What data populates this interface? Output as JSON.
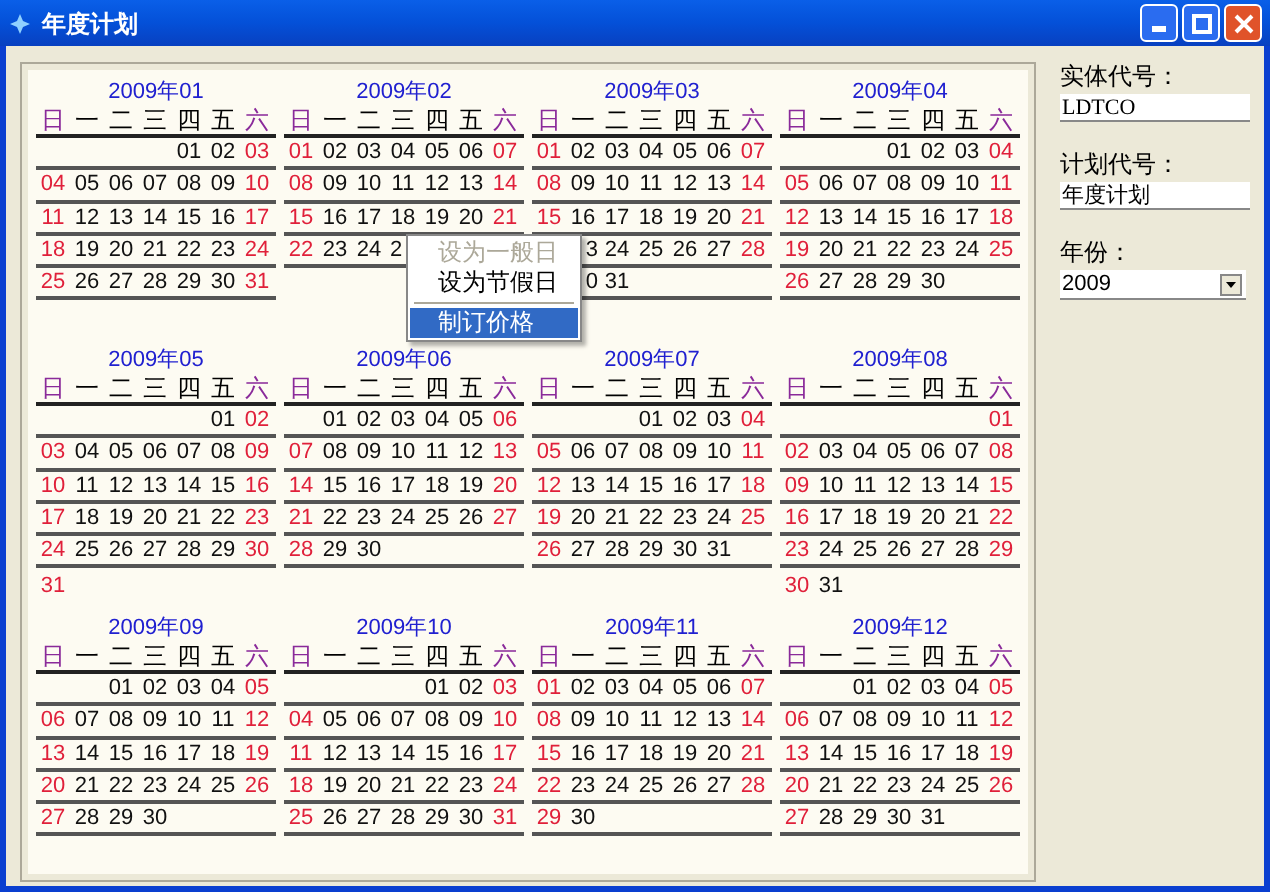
{
  "window": {
    "title": "年度计划"
  },
  "months": [
    {
      "title": "2009年01",
      "weekdays": [
        "日",
        "一",
        "二",
        "三",
        "四",
        "五",
        "六"
      ],
      "weeks": [
        [
          {
            "kind": "blank"
          },
          {
            "kind": "blank"
          },
          {
            "kind": "blank"
          },
          {
            "kind": "blank"
          },
          {
            "kind": "day",
            "text": "01"
          },
          {
            "kind": "day",
            "text": "02"
          },
          {
            "kind": "day",
            "text": "03"
          }
        ],
        [
          {
            "kind": "day",
            "text": "04"
          },
          {
            "kind": "day",
            "text": "05"
          },
          {
            "kind": "day",
            "text": "06"
          },
          {
            "kind": "day",
            "text": "07"
          },
          {
            "kind": "day",
            "text": "08"
          },
          {
            "kind": "day",
            "text": "09"
          },
          {
            "kind": "day",
            "text": "10"
          }
        ],
        [
          {
            "kind": "day",
            "text": "11"
          },
          {
            "kind": "day",
            "text": "12"
          },
          {
            "kind": "day",
            "text": "13"
          },
          {
            "kind": "day",
            "text": "14"
          },
          {
            "kind": "day",
            "text": "15"
          },
          {
            "kind": "day",
            "text": "16"
          },
          {
            "kind": "day",
            "text": "17"
          }
        ],
        [
          {
            "kind": "day",
            "text": "18"
          },
          {
            "kind": "day",
            "text": "19"
          },
          {
            "kind": "day",
            "text": "20"
          },
          {
            "kind": "day",
            "text": "21"
          },
          {
            "kind": "day",
            "text": "22"
          },
          {
            "kind": "day",
            "text": "23"
          },
          {
            "kind": "day",
            "text": "24"
          }
        ],
        [
          {
            "kind": "day",
            "text": "25"
          },
          {
            "kind": "day",
            "text": "26"
          },
          {
            "kind": "day",
            "text": "27"
          },
          {
            "kind": "day",
            "text": "28"
          },
          {
            "kind": "day",
            "text": "29"
          },
          {
            "kind": "day",
            "text": "30"
          },
          {
            "kind": "day",
            "text": "31"
          }
        ]
      ]
    },
    {
      "title": "2009年02",
      "weekdays": [
        "日",
        "一",
        "二",
        "三",
        "四",
        "五",
        "六"
      ],
      "weeks": [
        [
          {
            "kind": "day",
            "text": "01"
          },
          {
            "kind": "day",
            "text": "02"
          },
          {
            "kind": "day",
            "text": "03"
          },
          {
            "kind": "day",
            "text": "04"
          },
          {
            "kind": "day",
            "text": "05"
          },
          {
            "kind": "day",
            "text": "06"
          },
          {
            "kind": "day",
            "text": "07"
          }
        ],
        [
          {
            "kind": "day",
            "text": "08"
          },
          {
            "kind": "day",
            "text": "09"
          },
          {
            "kind": "day",
            "text": "10"
          },
          {
            "kind": "day",
            "text": "11"
          },
          {
            "kind": "day",
            "text": "12"
          },
          {
            "kind": "day",
            "text": "13"
          },
          {
            "kind": "day",
            "text": "14"
          }
        ],
        [
          {
            "kind": "day",
            "text": "15"
          },
          {
            "kind": "day",
            "text": "16"
          },
          {
            "kind": "day",
            "text": "17"
          },
          {
            "kind": "day",
            "text": "18"
          },
          {
            "kind": "day",
            "text": "19"
          },
          {
            "kind": "day",
            "text": "20"
          },
          {
            "kind": "day",
            "text": "21"
          }
        ],
        [
          {
            "kind": "day",
            "text": "22"
          },
          {
            "kind": "day",
            "text": "23"
          },
          {
            "kind": "day",
            "text": "24"
          },
          {
            "kind": "cut_start",
            "text": "2"
          }
        ]
      ]
    },
    {
      "title": "2009年03",
      "weekdays": [
        "日",
        "一",
        "二",
        "三",
        "四",
        "五",
        "六"
      ],
      "weeks": [
        [
          {
            "kind": "day",
            "text": "01"
          },
          {
            "kind": "day",
            "text": "02"
          },
          {
            "kind": "day",
            "text": "03"
          },
          {
            "kind": "day",
            "text": "04"
          },
          {
            "kind": "day",
            "text": "05"
          },
          {
            "kind": "day",
            "text": "06"
          },
          {
            "kind": "day",
            "text": "07"
          }
        ],
        [
          {
            "kind": "day",
            "text": "08"
          },
          {
            "kind": "day",
            "text": "09"
          },
          {
            "kind": "day",
            "text": "10"
          },
          {
            "kind": "day",
            "text": "11"
          },
          {
            "kind": "day",
            "text": "12"
          },
          {
            "kind": "day",
            "text": "13"
          },
          {
            "kind": "day",
            "text": "14"
          }
        ],
        [
          {
            "kind": "day",
            "text": "15"
          },
          {
            "kind": "day",
            "text": "16"
          },
          {
            "kind": "day",
            "text": "17"
          },
          {
            "kind": "day",
            "text": "18"
          },
          {
            "kind": "day",
            "text": "19"
          },
          {
            "kind": "day",
            "text": "20"
          },
          {
            "kind": "day",
            "text": "21"
          }
        ],
        [
          {
            "kind": "blank"
          },
          {
            "kind": "cut_end",
            "text": "3"
          },
          {
            "kind": "day",
            "text": "24"
          },
          {
            "kind": "day",
            "text": "25"
          },
          {
            "kind": "day",
            "text": "26"
          },
          {
            "kind": "day",
            "text": "27"
          },
          {
            "kind": "day",
            "text": "28"
          }
        ],
        [
          {
            "kind": "blank"
          },
          {
            "kind": "cut_end",
            "text": "0"
          },
          {
            "kind": "day",
            "text": "31"
          }
        ]
      ]
    },
    {
      "title": "2009年04",
      "weekdays": [
        "日",
        "一",
        "二",
        "三",
        "四",
        "五",
        "六"
      ],
      "weeks": [
        [
          {
            "kind": "blank"
          },
          {
            "kind": "blank"
          },
          {
            "kind": "blank"
          },
          {
            "kind": "day",
            "text": "01"
          },
          {
            "kind": "day",
            "text": "02"
          },
          {
            "kind": "day",
            "text": "03"
          },
          {
            "kind": "day",
            "text": "04"
          }
        ],
        [
          {
            "kind": "day",
            "text": "05"
          },
          {
            "kind": "day",
            "text": "06"
          },
          {
            "kind": "day",
            "text": "07"
          },
          {
            "kind": "day",
            "text": "08"
          },
          {
            "kind": "day",
            "text": "09"
          },
          {
            "kind": "day",
            "text": "10"
          },
          {
            "kind": "day",
            "text": "11"
          }
        ],
        [
          {
            "kind": "day",
            "text": "12"
          },
          {
            "kind": "day",
            "text": "13"
          },
          {
            "kind": "day",
            "text": "14"
          },
          {
            "kind": "day",
            "text": "15"
          },
          {
            "kind": "day",
            "text": "16"
          },
          {
            "kind": "day",
            "text": "17"
          },
          {
            "kind": "day",
            "text": "18"
          }
        ],
        [
          {
            "kind": "day",
            "text": "19"
          },
          {
            "kind": "day",
            "text": "20"
          },
          {
            "kind": "day",
            "text": "21"
          },
          {
            "kind": "day",
            "text": "22"
          },
          {
            "kind": "day",
            "text": "23"
          },
          {
            "kind": "day",
            "text": "24"
          },
          {
            "kind": "day",
            "text": "25"
          }
        ],
        [
          {
            "kind": "day",
            "text": "26"
          },
          {
            "kind": "day",
            "text": "27"
          },
          {
            "kind": "day",
            "text": "28"
          },
          {
            "kind": "day",
            "text": "29"
          },
          {
            "kind": "day",
            "text": "30"
          }
        ]
      ]
    },
    {
      "title": "2009年05",
      "weekdays": [
        "日",
        "一",
        "二",
        "三",
        "四",
        "五",
        "六"
      ],
      "weeks": [
        [
          {
            "kind": "blank"
          },
          {
            "kind": "blank"
          },
          {
            "kind": "blank"
          },
          {
            "kind": "blank"
          },
          {
            "kind": "blank"
          },
          {
            "kind": "day",
            "text": "01"
          },
          {
            "kind": "day",
            "text": "02"
          }
        ],
        [
          {
            "kind": "day",
            "text": "03"
          },
          {
            "kind": "day",
            "text": "04"
          },
          {
            "kind": "day",
            "text": "05"
          },
          {
            "kind": "day",
            "text": "06"
          },
          {
            "kind": "day",
            "text": "07"
          },
          {
            "kind": "day",
            "text": "08"
          },
          {
            "kind": "day",
            "text": "09"
          }
        ],
        [
          {
            "kind": "day",
            "text": "10"
          },
          {
            "kind": "day",
            "text": "11"
          },
          {
            "kind": "day",
            "text": "12"
          },
          {
            "kind": "day",
            "text": "13"
          },
          {
            "kind": "day",
            "text": "14"
          },
          {
            "kind": "day",
            "text": "15"
          },
          {
            "kind": "day",
            "text": "16"
          }
        ],
        [
          {
            "kind": "day",
            "text": "17"
          },
          {
            "kind": "day",
            "text": "18"
          },
          {
            "kind": "day",
            "text": "19"
          },
          {
            "kind": "day",
            "text": "20"
          },
          {
            "kind": "day",
            "text": "21"
          },
          {
            "kind": "day",
            "text": "22"
          },
          {
            "kind": "day",
            "text": "23"
          }
        ],
        [
          {
            "kind": "day",
            "text": "24"
          },
          {
            "kind": "day",
            "text": "25"
          },
          {
            "kind": "day",
            "text": "26"
          },
          {
            "kind": "day",
            "text": "27"
          },
          {
            "kind": "day",
            "text": "28"
          },
          {
            "kind": "day",
            "text": "29"
          },
          {
            "kind": "day",
            "text": "30"
          }
        ],
        [
          {
            "kind": "day",
            "text": "31"
          }
        ]
      ]
    },
    {
      "title": "2009年06",
      "weekdays": [
        "日",
        "一",
        "二",
        "三",
        "四",
        "五",
        "六"
      ],
      "weeks": [
        [
          {
            "kind": "blank"
          },
          {
            "kind": "day",
            "text": "01"
          },
          {
            "kind": "day",
            "text": "02"
          },
          {
            "kind": "day",
            "text": "03"
          },
          {
            "kind": "day",
            "text": "04"
          },
          {
            "kind": "day",
            "text": "05"
          },
          {
            "kind": "day",
            "text": "06"
          }
        ],
        [
          {
            "kind": "day",
            "text": "07"
          },
          {
            "kind": "day",
            "text": "08"
          },
          {
            "kind": "day",
            "text": "09"
          },
          {
            "kind": "day",
            "text": "10"
          },
          {
            "kind": "day",
            "text": "11"
          },
          {
            "kind": "day",
            "text": "12"
          },
          {
            "kind": "day",
            "text": "13"
          }
        ],
        [
          {
            "kind": "day",
            "text": "14"
          },
          {
            "kind": "day",
            "text": "15"
          },
          {
            "kind": "day",
            "text": "16"
          },
          {
            "kind": "day",
            "text": "17"
          },
          {
            "kind": "day",
            "text": "18"
          },
          {
            "kind": "day",
            "text": "19"
          },
          {
            "kind": "day",
            "text": "20"
          }
        ],
        [
          {
            "kind": "day",
            "text": "21"
          },
          {
            "kind": "day",
            "text": "22"
          },
          {
            "kind": "day",
            "text": "23"
          },
          {
            "kind": "day",
            "text": "24"
          },
          {
            "kind": "day",
            "text": "25"
          },
          {
            "kind": "day",
            "text": "26"
          },
          {
            "kind": "day",
            "text": "27"
          }
        ],
        [
          {
            "kind": "day",
            "text": "28"
          },
          {
            "kind": "day",
            "text": "29"
          },
          {
            "kind": "day",
            "text": "30"
          }
        ]
      ]
    },
    {
      "title": "2009年07",
      "weekdays": [
        "日",
        "一",
        "二",
        "三",
        "四",
        "五",
        "六"
      ],
      "weeks": [
        [
          {
            "kind": "blank"
          },
          {
            "kind": "blank"
          },
          {
            "kind": "blank"
          },
          {
            "kind": "day",
            "text": "01"
          },
          {
            "kind": "day",
            "text": "02"
          },
          {
            "kind": "day",
            "text": "03"
          },
          {
            "kind": "day",
            "text": "04"
          }
        ],
        [
          {
            "kind": "day",
            "text": "05"
          },
          {
            "kind": "day",
            "text": "06"
          },
          {
            "kind": "day",
            "text": "07"
          },
          {
            "kind": "day",
            "text": "08"
          },
          {
            "kind": "day",
            "text": "09"
          },
          {
            "kind": "day",
            "text": "10"
          },
          {
            "kind": "day",
            "text": "11"
          }
        ],
        [
          {
            "kind": "day",
            "text": "12"
          },
          {
            "kind": "day",
            "text": "13"
          },
          {
            "kind": "day",
            "text": "14"
          },
          {
            "kind": "day",
            "text": "15"
          },
          {
            "kind": "day",
            "text": "16"
          },
          {
            "kind": "day",
            "text": "17"
          },
          {
            "kind": "day",
            "text": "18"
          }
        ],
        [
          {
            "kind": "day",
            "text": "19"
          },
          {
            "kind": "day",
            "text": "20"
          },
          {
            "kind": "day",
            "text": "21"
          },
          {
            "kind": "day",
            "text": "22"
          },
          {
            "kind": "day",
            "text": "23"
          },
          {
            "kind": "day",
            "text": "24"
          },
          {
            "kind": "day",
            "text": "25"
          }
        ],
        [
          {
            "kind": "day",
            "text": "26"
          },
          {
            "kind": "day",
            "text": "27"
          },
          {
            "kind": "day",
            "text": "28"
          },
          {
            "kind": "day",
            "text": "29"
          },
          {
            "kind": "day",
            "text": "30"
          },
          {
            "kind": "day",
            "text": "31"
          }
        ]
      ]
    },
    {
      "title": "2009年08",
      "weekdays": [
        "日",
        "一",
        "二",
        "三",
        "四",
        "五",
        "六"
      ],
      "weeks": [
        [
          {
            "kind": "blank"
          },
          {
            "kind": "blank"
          },
          {
            "kind": "blank"
          },
          {
            "kind": "blank"
          },
          {
            "kind": "blank"
          },
          {
            "kind": "blank"
          },
          {
            "kind": "day",
            "text": "01"
          }
        ],
        [
          {
            "kind": "day",
            "text": "02"
          },
          {
            "kind": "day",
            "text": "03"
          },
          {
            "kind": "day",
            "text": "04"
          },
          {
            "kind": "day",
            "text": "05"
          },
          {
            "kind": "day",
            "text": "06"
          },
          {
            "kind": "day",
            "text": "07"
          },
          {
            "kind": "day",
            "text": "08"
          }
        ],
        [
          {
            "kind": "day",
            "text": "09"
          },
          {
            "kind": "day",
            "text": "10"
          },
          {
            "kind": "day",
            "text": "11"
          },
          {
            "kind": "day",
            "text": "12"
          },
          {
            "kind": "day",
            "text": "13"
          },
          {
            "kind": "day",
            "text": "14"
          },
          {
            "kind": "day",
            "text": "15"
          }
        ],
        [
          {
            "kind": "day",
            "text": "16"
          },
          {
            "kind": "day",
            "text": "17"
          },
          {
            "kind": "day",
            "text": "18"
          },
          {
            "kind": "day",
            "text": "19"
          },
          {
            "kind": "day",
            "text": "20"
          },
          {
            "kind": "day",
            "text": "21"
          },
          {
            "kind": "day",
            "text": "22"
          }
        ],
        [
          {
            "kind": "day",
            "text": "23"
          },
          {
            "kind": "day",
            "text": "24"
          },
          {
            "kind": "day",
            "text": "25"
          },
          {
            "kind": "day",
            "text": "26"
          },
          {
            "kind": "day",
            "text": "27"
          },
          {
            "kind": "day",
            "text": "28"
          },
          {
            "kind": "day",
            "text": "29"
          }
        ],
        [
          {
            "kind": "day",
            "text": "30"
          },
          {
            "kind": "day",
            "text": "31"
          }
        ]
      ]
    },
    {
      "title": "2009年09",
      "weekdays": [
        "日",
        "一",
        "二",
        "三",
        "四",
        "五",
        "六"
      ],
      "weeks": [
        [
          {
            "kind": "blank"
          },
          {
            "kind": "blank"
          },
          {
            "kind": "day",
            "text": "01"
          },
          {
            "kind": "day",
            "text": "02"
          },
          {
            "kind": "day",
            "text": "03"
          },
          {
            "kind": "day",
            "text": "04"
          },
          {
            "kind": "day",
            "text": "05"
          }
        ],
        [
          {
            "kind": "day",
            "text": "06"
          },
          {
            "kind": "day",
            "text": "07"
          },
          {
            "kind": "day",
            "text": "08"
          },
          {
            "kind": "day",
            "text": "09"
          },
          {
            "kind": "day",
            "text": "10"
          },
          {
            "kind": "day",
            "text": "11"
          },
          {
            "kind": "day",
            "text": "12"
          }
        ],
        [
          {
            "kind": "day",
            "text": "13"
          },
          {
            "kind": "day",
            "text": "14"
          },
          {
            "kind": "day",
            "text": "15"
          },
          {
            "kind": "day",
            "text": "16"
          },
          {
            "kind": "day",
            "text": "17"
          },
          {
            "kind": "day",
            "text": "18"
          },
          {
            "kind": "day",
            "text": "19"
          }
        ],
        [
          {
            "kind": "day",
            "text": "20"
          },
          {
            "kind": "day",
            "text": "21"
          },
          {
            "kind": "day",
            "text": "22"
          },
          {
            "kind": "day",
            "text": "23"
          },
          {
            "kind": "day",
            "text": "24"
          },
          {
            "kind": "day",
            "text": "25"
          },
          {
            "kind": "day",
            "text": "26"
          }
        ],
        [
          {
            "kind": "day",
            "text": "27"
          },
          {
            "kind": "day",
            "text": "28"
          },
          {
            "kind": "day",
            "text": "29"
          },
          {
            "kind": "day",
            "text": "30"
          }
        ]
      ]
    },
    {
      "title": "2009年10",
      "weekdays": [
        "日",
        "一",
        "二",
        "三",
        "四",
        "五",
        "六"
      ],
      "weeks": [
        [
          {
            "kind": "blank"
          },
          {
            "kind": "blank"
          },
          {
            "kind": "blank"
          },
          {
            "kind": "blank"
          },
          {
            "kind": "day",
            "text": "01"
          },
          {
            "kind": "day",
            "text": "02"
          },
          {
            "kind": "day",
            "text": "03"
          }
        ],
        [
          {
            "kind": "day",
            "text": "04"
          },
          {
            "kind": "day",
            "text": "05"
          },
          {
            "kind": "day",
            "text": "06"
          },
          {
            "kind": "day",
            "text": "07"
          },
          {
            "kind": "day",
            "text": "08"
          },
          {
            "kind": "day",
            "text": "09"
          },
          {
            "kind": "day",
            "text": "10"
          }
        ],
        [
          {
            "kind": "day",
            "text": "11"
          },
          {
            "kind": "day",
            "text": "12"
          },
          {
            "kind": "day",
            "text": "13"
          },
          {
            "kind": "day",
            "text": "14"
          },
          {
            "kind": "day",
            "text": "15"
          },
          {
            "kind": "day",
            "text": "16"
          },
          {
            "kind": "day",
            "text": "17"
          }
        ],
        [
          {
            "kind": "day",
            "text": "18"
          },
          {
            "kind": "day",
            "text": "19"
          },
          {
            "kind": "day",
            "text": "20"
          },
          {
            "kind": "day",
            "text": "21"
          },
          {
            "kind": "day",
            "text": "22"
          },
          {
            "kind": "day",
            "text": "23"
          },
          {
            "kind": "day",
            "text": "24"
          }
        ],
        [
          {
            "kind": "day",
            "text": "25"
          },
          {
            "kind": "day",
            "text": "26"
          },
          {
            "kind": "day",
            "text": "27"
          },
          {
            "kind": "day",
            "text": "28"
          },
          {
            "kind": "day",
            "text": "29"
          },
          {
            "kind": "day",
            "text": "30"
          },
          {
            "kind": "day",
            "text": "31"
          }
        ]
      ]
    },
    {
      "title": "2009年11",
      "weekdays": [
        "日",
        "一",
        "二",
        "三",
        "四",
        "五",
        "六"
      ],
      "weeks": [
        [
          {
            "kind": "day",
            "text": "01"
          },
          {
            "kind": "day",
            "text": "02"
          },
          {
            "kind": "day",
            "text": "03"
          },
          {
            "kind": "day",
            "text": "04"
          },
          {
            "kind": "day",
            "text": "05"
          },
          {
            "kind": "day",
            "text": "06"
          },
          {
            "kind": "day",
            "text": "07"
          }
        ],
        [
          {
            "kind": "day",
            "text": "08"
          },
          {
            "kind": "day",
            "text": "09"
          },
          {
            "kind": "day",
            "text": "10"
          },
          {
            "kind": "day",
            "text": "11"
          },
          {
            "kind": "day",
            "text": "12"
          },
          {
            "kind": "day",
            "text": "13"
          },
          {
            "kind": "day",
            "text": "14"
          }
        ],
        [
          {
            "kind": "day",
            "text": "15"
          },
          {
            "kind": "day",
            "text": "16"
          },
          {
            "kind": "day",
            "text": "17"
          },
          {
            "kind": "day",
            "text": "18"
          },
          {
            "kind": "day",
            "text": "19"
          },
          {
            "kind": "day",
            "text": "20"
          },
          {
            "kind": "day",
            "text": "21"
          }
        ],
        [
          {
            "kind": "day",
            "text": "22"
          },
          {
            "kind": "day",
            "text": "23"
          },
          {
            "kind": "day",
            "text": "24"
          },
          {
            "kind": "day",
            "text": "25"
          },
          {
            "kind": "day",
            "text": "26"
          },
          {
            "kind": "day",
            "text": "27"
          },
          {
            "kind": "day",
            "text": "28"
          }
        ],
        [
          {
            "kind": "day",
            "text": "29"
          },
          {
            "kind": "day",
            "text": "30"
          }
        ]
      ]
    },
    {
      "title": "2009年12",
      "weekdays": [
        "日",
        "一",
        "二",
        "三",
        "四",
        "五",
        "六"
      ],
      "weeks": [
        [
          {
            "kind": "blank"
          },
          {
            "kind": "blank"
          },
          {
            "kind": "day",
            "text": "01"
          },
          {
            "kind": "day",
            "text": "02"
          },
          {
            "kind": "day",
            "text": "03"
          },
          {
            "kind": "day",
            "text": "04"
          },
          {
            "kind": "day",
            "text": "05"
          }
        ],
        [
          {
            "kind": "day",
            "text": "06"
          },
          {
            "kind": "day",
            "text": "07"
          },
          {
            "kind": "day",
            "text": "08"
          },
          {
            "kind": "day",
            "text": "09"
          },
          {
            "kind": "day",
            "text": "10"
          },
          {
            "kind": "day",
            "text": "11"
          },
          {
            "kind": "day",
            "text": "12"
          }
        ],
        [
          {
            "kind": "day",
            "text": "13"
          },
          {
            "kind": "day",
            "text": "14"
          },
          {
            "kind": "day",
            "text": "15"
          },
          {
            "kind": "day",
            "text": "16"
          },
          {
            "kind": "day",
            "text": "17"
          },
          {
            "kind": "day",
            "text": "18"
          },
          {
            "kind": "day",
            "text": "19"
          }
        ],
        [
          {
            "kind": "day",
            "text": "20"
          },
          {
            "kind": "day",
            "text": "21"
          },
          {
            "kind": "day",
            "text": "22"
          },
          {
            "kind": "day",
            "text": "23"
          },
          {
            "kind": "day",
            "text": "24"
          },
          {
            "kind": "day",
            "text": "25"
          },
          {
            "kind": "day",
            "text": "26"
          }
        ],
        [
          {
            "kind": "day",
            "text": "27"
          },
          {
            "kind": "day",
            "text": "28"
          },
          {
            "kind": "day",
            "text": "29"
          },
          {
            "kind": "day",
            "text": "30"
          },
          {
            "kind": "day",
            "text": "31"
          }
        ]
      ]
    }
  ],
  "context_menu": [
    {
      "kind": "item",
      "label": "设为一般日",
      "disabled": true,
      "selected": false
    },
    {
      "kind": "item",
      "label": "设为节假日",
      "disabled": false,
      "selected": false
    },
    {
      "kind": "separator"
    },
    {
      "kind": "item",
      "label": "制订价格",
      "disabled": false,
      "selected": true
    }
  ],
  "side_panel": {
    "fields": [
      {
        "kind": "text",
        "label": "实体代号：",
        "value": "LDTCO"
      },
      {
        "kind": "text",
        "label": "计划代号：",
        "value": "年度计划"
      },
      {
        "kind": "select",
        "label": "年份：",
        "value": "2009"
      }
    ]
  }
}
